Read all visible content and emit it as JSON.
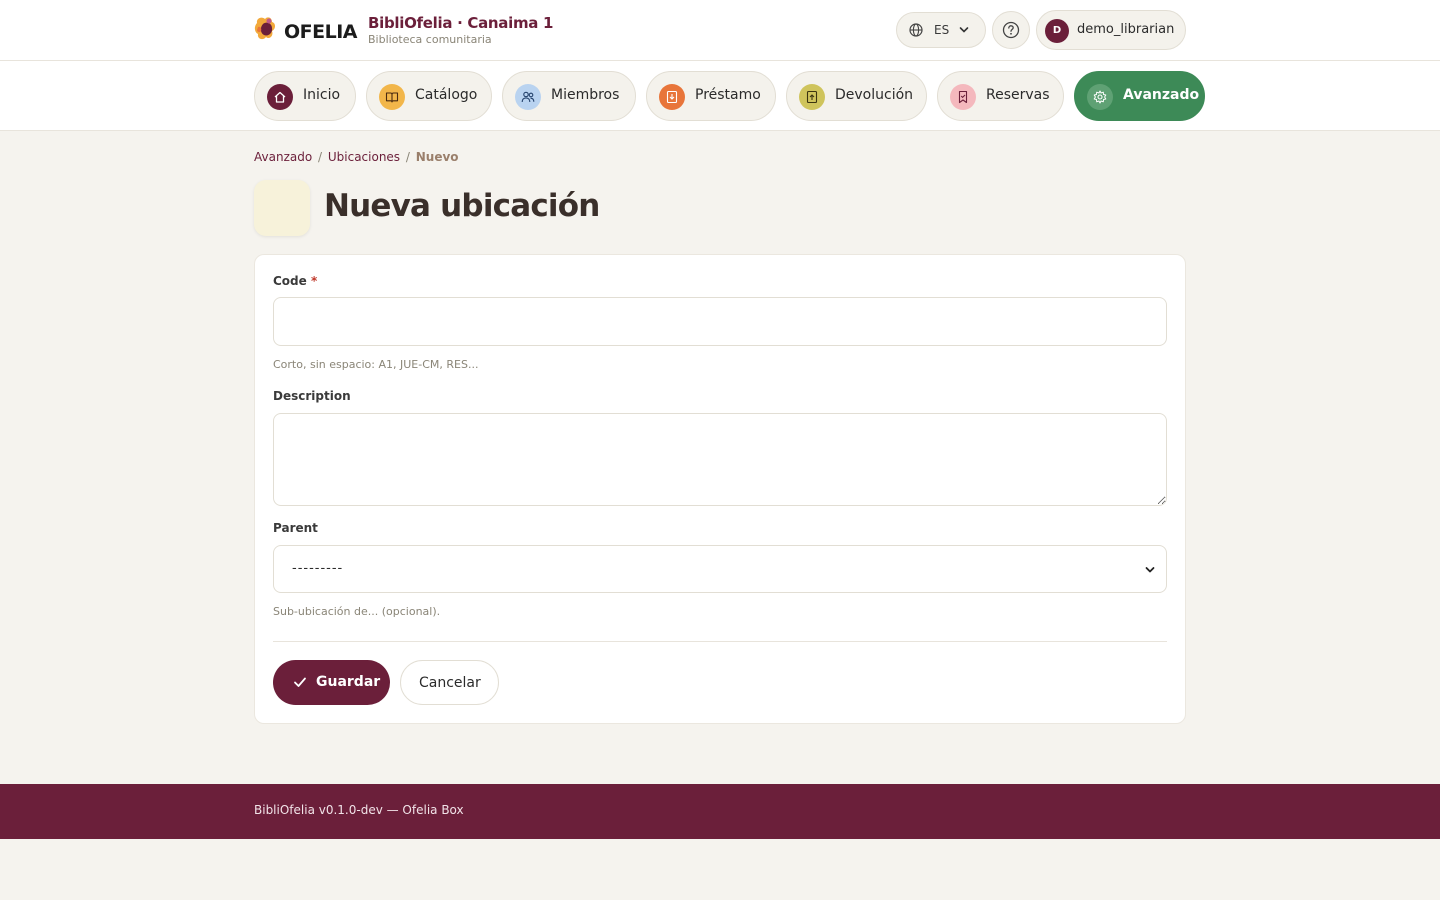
{
  "header": {
    "logo_text": "OFELIA",
    "brand_title": "BibliOfelia · Canaima 1",
    "brand_subtitle": "Biblioteca comunitaria",
    "language": "ES",
    "user_initial": "D",
    "username": "demo_librarian"
  },
  "nav": {
    "items": [
      {
        "label": "Inicio",
        "icon": "home-icon",
        "color": "#6b1f3a"
      },
      {
        "label": "Catálogo",
        "icon": "book-icon",
        "color": "#f2b64a"
      },
      {
        "label": "Miembros",
        "icon": "users-icon",
        "color": "#b9d3f0"
      },
      {
        "label": "Préstamo",
        "icon": "loan-icon",
        "color": "#e8753a"
      },
      {
        "label": "Devolución",
        "icon": "return-icon",
        "color": "#cfc45c"
      },
      {
        "label": "Reservas",
        "icon": "bookmark-icon",
        "color": "#f4b8bd"
      },
      {
        "label": "Avanzado",
        "icon": "gear-icon",
        "color": "#5fa174"
      }
    ],
    "active_index": 6
  },
  "breadcrumb": {
    "items": [
      "Avanzado",
      "Ubicaciones"
    ],
    "current": "Nuevo"
  },
  "page": {
    "title": "Nueva ubicación"
  },
  "form": {
    "code": {
      "label": "Code",
      "required_mark": "*",
      "value": "",
      "help": "Corto, sin espacio: A1, JUE-CM, RES..."
    },
    "description": {
      "label": "Description",
      "value": ""
    },
    "parent": {
      "label": "Parent",
      "selected": "---------",
      "help": "Sub-ubicación de... (opcional)."
    },
    "save_label": "Guardar",
    "cancel_label": "Cancelar"
  },
  "footer": {
    "text": "BibliOfelia v0.1.0-dev — Ofelia Box"
  },
  "colors": {
    "brand": "#6b1f3a",
    "accent_green": "#3d8a57",
    "background": "#f5f3ee"
  }
}
